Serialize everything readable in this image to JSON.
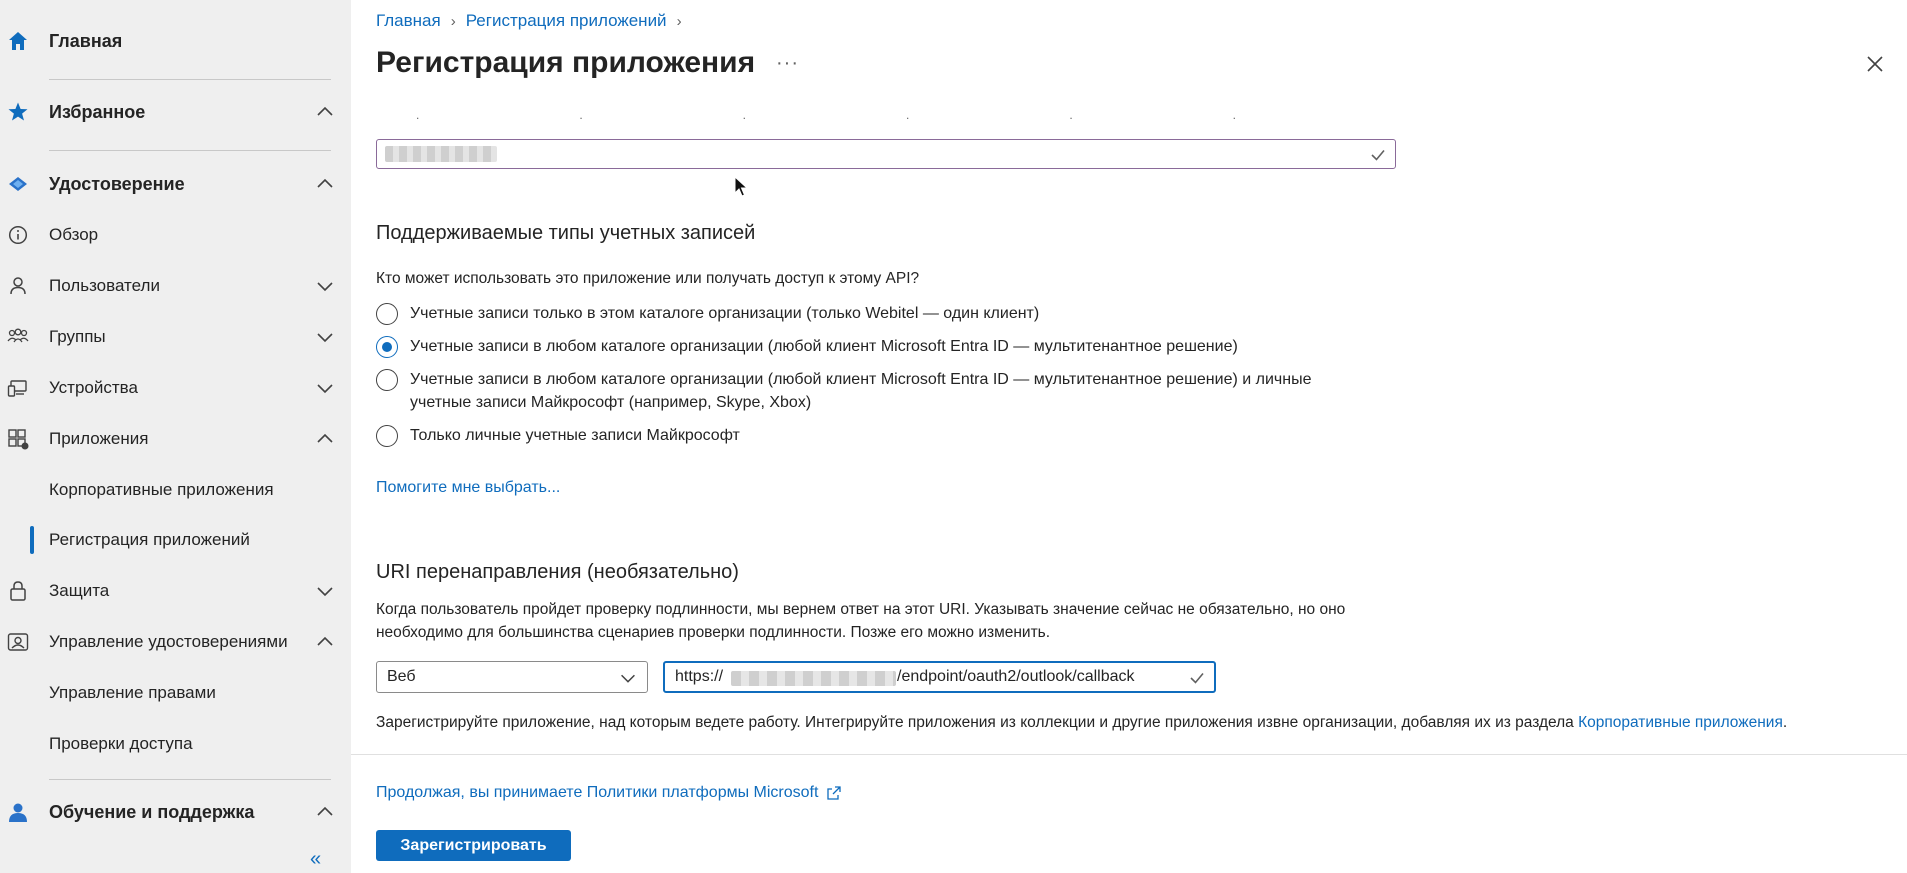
{
  "sidebar": {
    "home": "Главная",
    "favorites": "Избранное",
    "identity": "Удостоверение",
    "items": [
      {
        "label": "Обзор"
      },
      {
        "label": "Пользователи"
      },
      {
        "label": "Группы"
      },
      {
        "label": "Устройства"
      },
      {
        "label": "Приложения"
      },
      {
        "label": "Корпоративные приложения"
      },
      {
        "label": "Регистрация приложений"
      },
      {
        "label": "Защита"
      },
      {
        "label": "Управление удостоверениями"
      },
      {
        "label": "Управление правами"
      },
      {
        "label": "Проверки доступа"
      }
    ],
    "learn": "Обучение и поддержка",
    "collapse_glyph": "«"
  },
  "header": {
    "breadcrumb": [
      "Главная",
      "Регистрация приложений"
    ],
    "title": "Регистрация приложения",
    "more": "···"
  },
  "form": {
    "account_types_title": "Поддерживаемые типы учетных записей",
    "account_types_question": "Кто может использовать это приложение или получать доступ к этому API?",
    "options": [
      {
        "label": "Учетные записи только в этом каталоге организации (только Webitel — один клиент)",
        "checked": false
      },
      {
        "label": "Учетные записи в любом каталоге организации (любой клиент Microsoft Entra ID — мультитенантное решение)",
        "checked": true
      },
      {
        "label": "Учетные записи в любом каталоге организации (любой клиент Microsoft Entra ID — мультитенантное решение) и личные учетные записи Майкрософт (например, Skype, Xbox)",
        "checked": false
      },
      {
        "label": "Только личные учетные записи Майкрософт",
        "checked": false
      }
    ],
    "help_link": "Помогите мне выбрать...",
    "redirect_title": "URI перенаправления (необязательно)",
    "redirect_desc": "Когда пользователь пройдет проверку подлинности, мы вернем ответ на этот URI. Указывать значение сейчас не обязательно, но оно необходимо для большинства сценариев проверки подлинности. Позже его можно изменить.",
    "platform_value": "Веб",
    "uri_prefix": "https://",
    "uri_suffix": "/endpoint/oauth2/outlook/callback",
    "register_note": "Зарегистрируйте приложение, над которым ведете работу. Интегрируйте приложения из коллекции и другие приложения извне организации, добавляя их из раздела ",
    "register_note_link": "Корпоративные приложения",
    "register_note_end": "."
  },
  "footer": {
    "policy_link": "Продолжая, вы принимаете Политики платформы Microsoft",
    "register_button": "Зарегистрировать"
  },
  "colors": {
    "accent": "#0f6cbd",
    "sidebar_bg": "#efefef"
  }
}
